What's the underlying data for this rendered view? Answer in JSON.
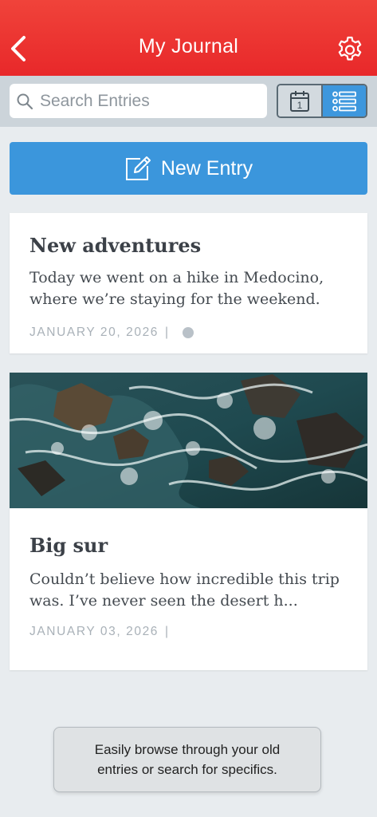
{
  "header": {
    "title": "My Journal",
    "back_icon": "chevron-left-icon",
    "settings_icon": "gear-icon",
    "accent_color": "#e9302c"
  },
  "search": {
    "placeholder": "Search Entries",
    "value": "",
    "icon": "search-icon"
  },
  "view_toggle": {
    "options": [
      "calendar",
      "list"
    ],
    "selected": "list",
    "calendar_day": "1"
  },
  "new_entry": {
    "label": "New Entry",
    "icon": "compose-icon",
    "color": "#3b96dc"
  },
  "entries": [
    {
      "title": "New adventures",
      "excerpt": "Today we went on a hike in Medocino, where we’re staying for the weekend.",
      "date": "JANUARY 20, 2026",
      "separator": "|",
      "has_image": false
    },
    {
      "title": "Big sur",
      "excerpt": "Couldn’t believe how incredible this trip was. I’ve never seen the desert h...",
      "date": "JANUARY 03, 2026",
      "separator": "|",
      "has_image": true,
      "image_icon": "ocean-photo"
    }
  ],
  "tooltip": {
    "text": "Easily browse through your old entries or search for specifics."
  }
}
